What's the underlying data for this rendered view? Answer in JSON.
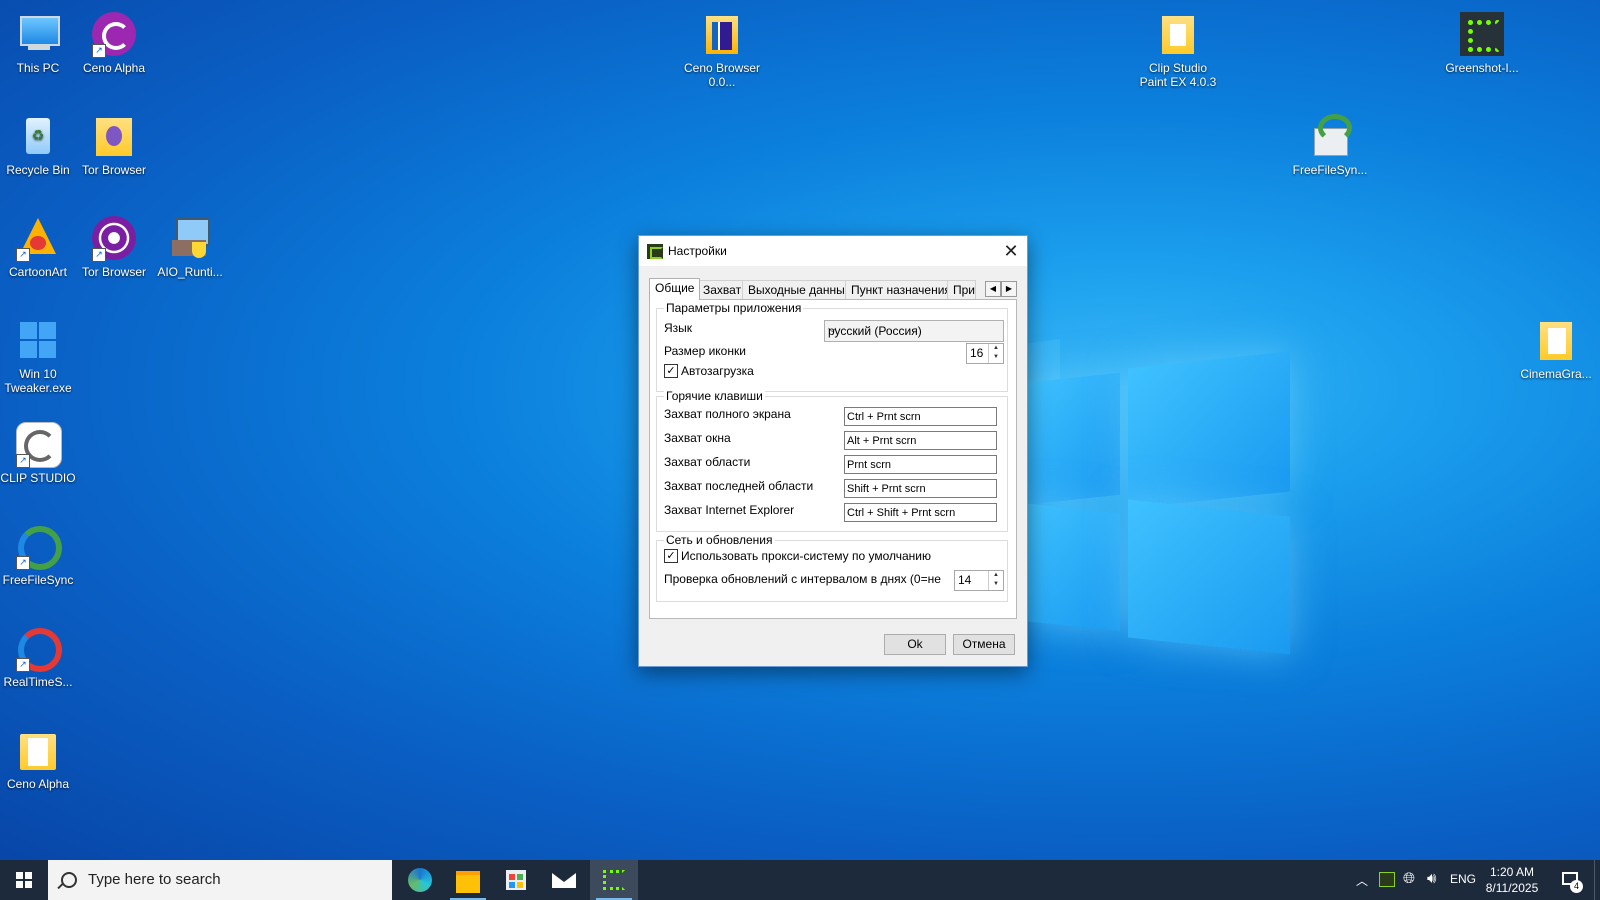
{
  "desktop": {
    "icons": [
      {
        "label": "This PC"
      },
      {
        "label": "Ceno Alpha"
      },
      {
        "label": "Recycle Bin"
      },
      {
        "label": "Tor Browser"
      },
      {
        "label": "CartoonArt"
      },
      {
        "label": "Tor Browser"
      },
      {
        "label": "AIO_Runti..."
      },
      {
        "label": "Win 10 Tweaker.exe"
      },
      {
        "label": "CLIP STUDIO"
      },
      {
        "label": "FreeFileSync"
      },
      {
        "label": "RealTimeS..."
      },
      {
        "label": "Ceno Alpha"
      },
      {
        "label": "Ceno Browser 0.0..."
      },
      {
        "label": "Clip Studio Paint EX 4.0.3"
      },
      {
        "label": "Greenshot-I..."
      },
      {
        "label": "FreeFileSyn..."
      },
      {
        "label": "CinemaGra..."
      }
    ]
  },
  "dialog": {
    "title": "Настройки",
    "tabs": [
      "Общие",
      "Захват",
      "Выходные данные",
      "Пункт назначения",
      "Прим"
    ],
    "app_params": {
      "legend": "Параметры приложения",
      "language_label": "Язык",
      "language_value": "русский (Россия)",
      "icon_size_label": "Размер иконки",
      "icon_size_value": "16",
      "autostart_label": "Автозагрузка",
      "autostart_checked": true
    },
    "hotkeys": {
      "legend": "Горячие клавиши",
      "rows": [
        {
          "label": "Захват полного экрана",
          "value": "Ctrl + Prnt scrn"
        },
        {
          "label": "Захват окна",
          "value": "Alt + Prnt scrn"
        },
        {
          "label": "Захват области",
          "value": "Prnt scrn"
        },
        {
          "label": "Захват последней области",
          "value": "Shift + Prnt scrn"
        },
        {
          "label": "Захват Internet Explorer",
          "value": "Ctrl + Shift + Prnt scrn"
        }
      ]
    },
    "network": {
      "legend": "Сеть и обновления",
      "proxy_label": "Использовать прокси-систему по умолчанию",
      "proxy_checked": true,
      "update_label": "Проверка обновлений с интервалом в днях (0=не",
      "update_value": "14"
    },
    "ok_label": "Ok",
    "cancel_label": "Отмена"
  },
  "taskbar": {
    "search_placeholder": "Type here to search",
    "language": "ENG",
    "time": "1:20 AM",
    "date": "8/11/2025",
    "notification_count": "4"
  }
}
